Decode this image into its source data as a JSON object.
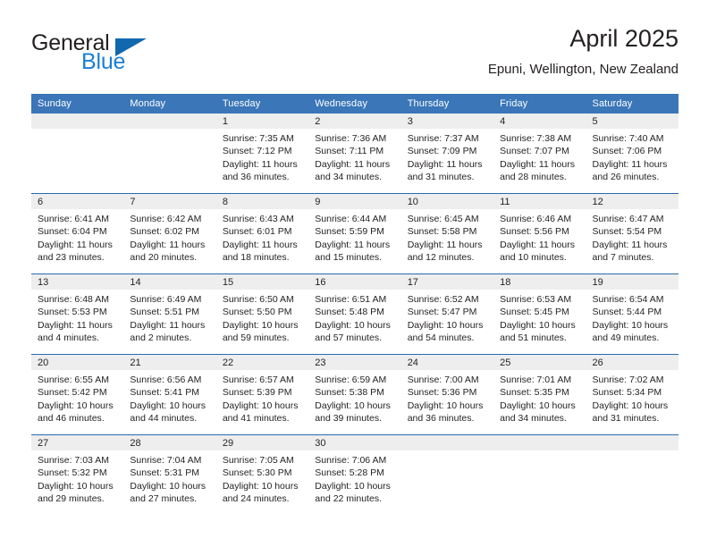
{
  "brand": {
    "name_part1": "General",
    "name_part2": "Blue",
    "flag_icon": "triangle-flag-icon",
    "accent_color": "#1168ad",
    "blue_text_color": "#1b7fd4"
  },
  "header": {
    "title": "April 2025",
    "subtitle": "Epuni, Wellington, New Zealand"
  },
  "theme": {
    "header_bg": "#3a76b8",
    "row_divider": "#2a6aad",
    "daynum_band_bg": "#eeeeee",
    "text_color": "#231f20"
  },
  "weekday_headers": [
    "Sunday",
    "Monday",
    "Tuesday",
    "Wednesday",
    "Thursday",
    "Friday",
    "Saturday"
  ],
  "weeks": [
    [
      {
        "day": "",
        "sunrise": "",
        "sunset": "",
        "daylight_line1": "",
        "daylight_line2": "",
        "empty": true
      },
      {
        "day": "",
        "sunrise": "",
        "sunset": "",
        "daylight_line1": "",
        "daylight_line2": "",
        "empty": true
      },
      {
        "day": "1",
        "sunrise": "Sunrise: 7:35 AM",
        "sunset": "Sunset: 7:12 PM",
        "daylight_line1": "Daylight: 11 hours",
        "daylight_line2": "and 36 minutes."
      },
      {
        "day": "2",
        "sunrise": "Sunrise: 7:36 AM",
        "sunset": "Sunset: 7:11 PM",
        "daylight_line1": "Daylight: 11 hours",
        "daylight_line2": "and 34 minutes."
      },
      {
        "day": "3",
        "sunrise": "Sunrise: 7:37 AM",
        "sunset": "Sunset: 7:09 PM",
        "daylight_line1": "Daylight: 11 hours",
        "daylight_line2": "and 31 minutes."
      },
      {
        "day": "4",
        "sunrise": "Sunrise: 7:38 AM",
        "sunset": "Sunset: 7:07 PM",
        "daylight_line1": "Daylight: 11 hours",
        "daylight_line2": "and 28 minutes."
      },
      {
        "day": "5",
        "sunrise": "Sunrise: 7:40 AM",
        "sunset": "Sunset: 7:06 PM",
        "daylight_line1": "Daylight: 11 hours",
        "daylight_line2": "and 26 minutes."
      }
    ],
    [
      {
        "day": "6",
        "sunrise": "Sunrise: 6:41 AM",
        "sunset": "Sunset: 6:04 PM",
        "daylight_line1": "Daylight: 11 hours",
        "daylight_line2": "and 23 minutes."
      },
      {
        "day": "7",
        "sunrise": "Sunrise: 6:42 AM",
        "sunset": "Sunset: 6:02 PM",
        "daylight_line1": "Daylight: 11 hours",
        "daylight_line2": "and 20 minutes."
      },
      {
        "day": "8",
        "sunrise": "Sunrise: 6:43 AM",
        "sunset": "Sunset: 6:01 PM",
        "daylight_line1": "Daylight: 11 hours",
        "daylight_line2": "and 18 minutes."
      },
      {
        "day": "9",
        "sunrise": "Sunrise: 6:44 AM",
        "sunset": "Sunset: 5:59 PM",
        "daylight_line1": "Daylight: 11 hours",
        "daylight_line2": "and 15 minutes."
      },
      {
        "day": "10",
        "sunrise": "Sunrise: 6:45 AM",
        "sunset": "Sunset: 5:58 PM",
        "daylight_line1": "Daylight: 11 hours",
        "daylight_line2": "and 12 minutes."
      },
      {
        "day": "11",
        "sunrise": "Sunrise: 6:46 AM",
        "sunset": "Sunset: 5:56 PM",
        "daylight_line1": "Daylight: 11 hours",
        "daylight_line2": "and 10 minutes."
      },
      {
        "day": "12",
        "sunrise": "Sunrise: 6:47 AM",
        "sunset": "Sunset: 5:54 PM",
        "daylight_line1": "Daylight: 11 hours",
        "daylight_line2": "and 7 minutes."
      }
    ],
    [
      {
        "day": "13",
        "sunrise": "Sunrise: 6:48 AM",
        "sunset": "Sunset: 5:53 PM",
        "daylight_line1": "Daylight: 11 hours",
        "daylight_line2": "and 4 minutes."
      },
      {
        "day": "14",
        "sunrise": "Sunrise: 6:49 AM",
        "sunset": "Sunset: 5:51 PM",
        "daylight_line1": "Daylight: 11 hours",
        "daylight_line2": "and 2 minutes."
      },
      {
        "day": "15",
        "sunrise": "Sunrise: 6:50 AM",
        "sunset": "Sunset: 5:50 PM",
        "daylight_line1": "Daylight: 10 hours",
        "daylight_line2": "and 59 minutes."
      },
      {
        "day": "16",
        "sunrise": "Sunrise: 6:51 AM",
        "sunset": "Sunset: 5:48 PM",
        "daylight_line1": "Daylight: 10 hours",
        "daylight_line2": "and 57 minutes."
      },
      {
        "day": "17",
        "sunrise": "Sunrise: 6:52 AM",
        "sunset": "Sunset: 5:47 PM",
        "daylight_line1": "Daylight: 10 hours",
        "daylight_line2": "and 54 minutes."
      },
      {
        "day": "18",
        "sunrise": "Sunrise: 6:53 AM",
        "sunset": "Sunset: 5:45 PM",
        "daylight_line1": "Daylight: 10 hours",
        "daylight_line2": "and 51 minutes."
      },
      {
        "day": "19",
        "sunrise": "Sunrise: 6:54 AM",
        "sunset": "Sunset: 5:44 PM",
        "daylight_line1": "Daylight: 10 hours",
        "daylight_line2": "and 49 minutes."
      }
    ],
    [
      {
        "day": "20",
        "sunrise": "Sunrise: 6:55 AM",
        "sunset": "Sunset: 5:42 PM",
        "daylight_line1": "Daylight: 10 hours",
        "daylight_line2": "and 46 minutes."
      },
      {
        "day": "21",
        "sunrise": "Sunrise: 6:56 AM",
        "sunset": "Sunset: 5:41 PM",
        "daylight_line1": "Daylight: 10 hours",
        "daylight_line2": "and 44 minutes."
      },
      {
        "day": "22",
        "sunrise": "Sunrise: 6:57 AM",
        "sunset": "Sunset: 5:39 PM",
        "daylight_line1": "Daylight: 10 hours",
        "daylight_line2": "and 41 minutes."
      },
      {
        "day": "23",
        "sunrise": "Sunrise: 6:59 AM",
        "sunset": "Sunset: 5:38 PM",
        "daylight_line1": "Daylight: 10 hours",
        "daylight_line2": "and 39 minutes."
      },
      {
        "day": "24",
        "sunrise": "Sunrise: 7:00 AM",
        "sunset": "Sunset: 5:36 PM",
        "daylight_line1": "Daylight: 10 hours",
        "daylight_line2": "and 36 minutes."
      },
      {
        "day": "25",
        "sunrise": "Sunrise: 7:01 AM",
        "sunset": "Sunset: 5:35 PM",
        "daylight_line1": "Daylight: 10 hours",
        "daylight_line2": "and 34 minutes."
      },
      {
        "day": "26",
        "sunrise": "Sunrise: 7:02 AM",
        "sunset": "Sunset: 5:34 PM",
        "daylight_line1": "Daylight: 10 hours",
        "daylight_line2": "and 31 minutes."
      }
    ],
    [
      {
        "day": "27",
        "sunrise": "Sunrise: 7:03 AM",
        "sunset": "Sunset: 5:32 PM",
        "daylight_line1": "Daylight: 10 hours",
        "daylight_line2": "and 29 minutes."
      },
      {
        "day": "28",
        "sunrise": "Sunrise: 7:04 AM",
        "sunset": "Sunset: 5:31 PM",
        "daylight_line1": "Daylight: 10 hours",
        "daylight_line2": "and 27 minutes."
      },
      {
        "day": "29",
        "sunrise": "Sunrise: 7:05 AM",
        "sunset": "Sunset: 5:30 PM",
        "daylight_line1": "Daylight: 10 hours",
        "daylight_line2": "and 24 minutes."
      },
      {
        "day": "30",
        "sunrise": "Sunrise: 7:06 AM",
        "sunset": "Sunset: 5:28 PM",
        "daylight_line1": "Daylight: 10 hours",
        "daylight_line2": "and 22 minutes."
      },
      {
        "day": "",
        "sunrise": "",
        "sunset": "",
        "daylight_line1": "",
        "daylight_line2": "",
        "empty": true
      },
      {
        "day": "",
        "sunrise": "",
        "sunset": "",
        "daylight_line1": "",
        "daylight_line2": "",
        "empty": true
      },
      {
        "day": "",
        "sunrise": "",
        "sunset": "",
        "daylight_line1": "",
        "daylight_line2": "",
        "empty": true
      }
    ]
  ]
}
